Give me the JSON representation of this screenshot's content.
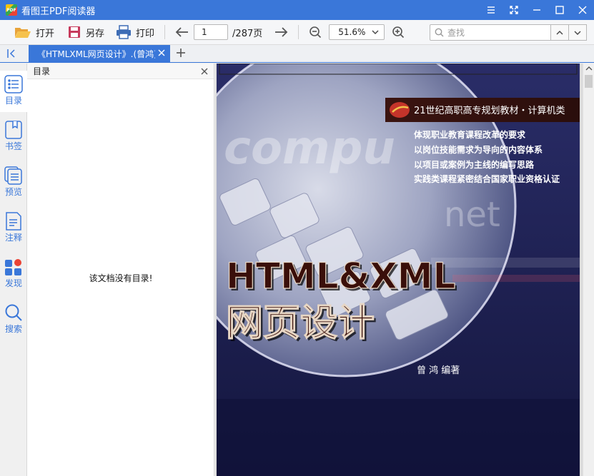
{
  "app": {
    "title": "看图王PDF阅读器",
    "logo_text": "PDF"
  },
  "toolbar": {
    "open_label": "打开",
    "save_as_label": "另存",
    "print_label": "打印",
    "page_current": "1",
    "page_total": "/287页",
    "zoom": "51.6%",
    "search_placeholder": "查找"
  },
  "tabs": [
    {
      "label": "《HTMLXML网页设计》.(曾鸿)"
    }
  ],
  "sidebar": {
    "items": [
      {
        "label": "目录",
        "icon": "list-icon"
      },
      {
        "label": "书签",
        "icon": "bookmark-icon"
      },
      {
        "label": "预览",
        "icon": "preview-icon"
      },
      {
        "label": "注释",
        "icon": "note-icon"
      },
      {
        "label": "发现",
        "icon": "discover-icon"
      },
      {
        "label": "搜索",
        "icon": "search-icon"
      }
    ]
  },
  "outline": {
    "title": "目录",
    "empty_message": "该文档没有目录!"
  },
  "cover": {
    "series": "21世纪高职高专规划教材・计算机类",
    "features": [
      "体现职业教育课程改革的要求",
      "以岗位技能需求为导向的内容体系",
      "以项目或案例为主线的编写思路",
      "实践类课程紧密结合国家职业资格认证"
    ],
    "title_line1": "HTML&XML",
    "title_line2": "网页设计",
    "author": "曾 鸿 编著",
    "bg_word1": "compu",
    "bg_word2": "net"
  },
  "colors": {
    "accent": "#3a77d9",
    "cover_dark": "#1a1c4a"
  }
}
